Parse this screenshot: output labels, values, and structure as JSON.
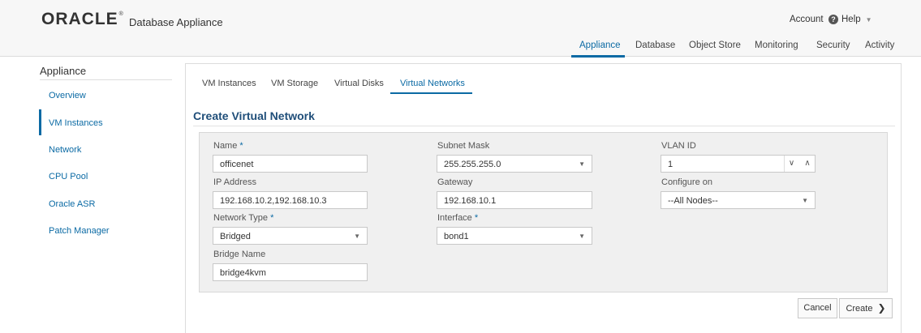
{
  "header": {
    "logo": "ORACLE",
    "logo_mark": "®",
    "app_name": "Database Appliance",
    "account_label": "Account",
    "help_label": "Help",
    "help_icon": "?",
    "caret": "▼"
  },
  "topnav": {
    "tabs": [
      {
        "label": "Appliance",
        "active": true
      },
      {
        "label": "Database"
      },
      {
        "label": "Object Store"
      },
      {
        "label": "Monitoring"
      },
      {
        "label": "Security"
      },
      {
        "label": "Activity"
      }
    ]
  },
  "sidebar": {
    "title": "Appliance",
    "items": [
      {
        "label": "Overview"
      },
      {
        "label": "VM Instances",
        "active": true
      },
      {
        "label": "Network"
      },
      {
        "label": "CPU Pool"
      },
      {
        "label": "Oracle ASR"
      },
      {
        "label": "Patch Manager"
      }
    ]
  },
  "subtabs": [
    {
      "label": "VM Instances"
    },
    {
      "label": "VM Storage"
    },
    {
      "label": "Virtual Disks"
    },
    {
      "label": "Virtual Networks",
      "active": true
    }
  ],
  "form": {
    "title": "Create Virtual Network",
    "required_mark": "*",
    "name_label": "Name",
    "name_value": "officenet",
    "subnet_label": "Subnet Mask",
    "subnet_value": "255.255.255.0",
    "vlan_label": "VLAN ID",
    "vlan_value": "1",
    "ip_label": "IP Address",
    "ip_value": "192.168.10.2,192.168.10.3",
    "gateway_label": "Gateway",
    "gateway_value": "192.168.10.1",
    "configure_label": "Configure on",
    "configure_value": "--All Nodes--",
    "network_type_label": "Network Type",
    "network_type_value": "Bridged",
    "interface_label": "Interface",
    "interface_value": "bond1",
    "bridge_label": "Bridge Name",
    "bridge_value": "bridge4kvm"
  },
  "buttons": {
    "cancel": "Cancel",
    "create": "Create",
    "create_chevron": "❯"
  },
  "colors": {
    "accent": "#0b6aa4",
    "title": "#1f4e79"
  }
}
